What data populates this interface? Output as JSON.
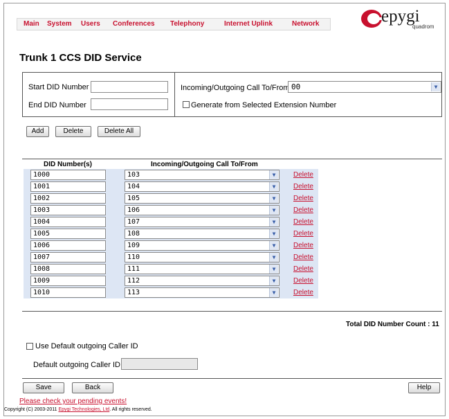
{
  "nav": {
    "items": [
      "Main",
      "System",
      "Users",
      "Conferences",
      "Telephony",
      "Internet Uplink",
      "Network"
    ]
  },
  "logo": {
    "brand": "epygi",
    "sub": "quadrom"
  },
  "page": {
    "title": "Trunk 1 CCS DID Service"
  },
  "form": {
    "start_label": "Start DID Number",
    "start_value": "",
    "end_label": "End DID Number",
    "end_value": "",
    "callto_label": "Incoming/Outgoing Call To/From",
    "callto_value": "00",
    "generate_label": "Generate from Selected Extension Number"
  },
  "actions": {
    "add": "Add",
    "delete": "Delete",
    "delete_all": "Delete All"
  },
  "table": {
    "col_did": "DID Number(s)",
    "col_callto": "Incoming/Outgoing Call To/From",
    "delete_label": "Delete",
    "rows": [
      {
        "did": "1000",
        "callto": "103"
      },
      {
        "did": "1001",
        "callto": "104"
      },
      {
        "did": "1002",
        "callto": "105"
      },
      {
        "did": "1003",
        "callto": "106"
      },
      {
        "did": "1004",
        "callto": "107"
      },
      {
        "did": "1005",
        "callto": "108"
      },
      {
        "did": "1006",
        "callto": "109"
      },
      {
        "did": "1007",
        "callto": "110"
      },
      {
        "did": "1008",
        "callto": "111"
      },
      {
        "did": "1009",
        "callto": "112"
      },
      {
        "did": "1010",
        "callto": "113"
      }
    ]
  },
  "total": "Total DID Number Count : 11",
  "caller_id": {
    "use_default_label": "Use Default outgoing Caller ID",
    "default_label": "Default outgoing Caller ID",
    "default_value": ""
  },
  "footer": {
    "save": "Save",
    "back": "Back",
    "help": "Help",
    "pending": "Please check your pending events!",
    "copyright_prefix": "Copyright (C) 2003-2011 ",
    "copyright_company": "Epygi Technologies, Ltd",
    "copyright_suffix": ". All rights reserved."
  },
  "colors": {
    "accent_red": "#c8102e",
    "row_blue": "#dde6f4"
  }
}
